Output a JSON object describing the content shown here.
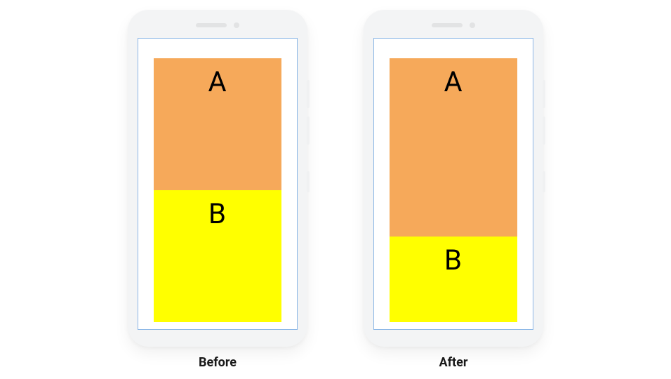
{
  "colors": {
    "block_a": "#f6a95a",
    "block_b": "#ffff00"
  },
  "phones": [
    {
      "caption": "Before",
      "block_a_label": "A",
      "block_b_label": "B",
      "a_flex": 1,
      "b_flex": 1
    },
    {
      "caption": "After",
      "block_a_label": "A",
      "block_b_label": "B",
      "a_flex": 2.2,
      "b_flex": 1
    }
  ]
}
